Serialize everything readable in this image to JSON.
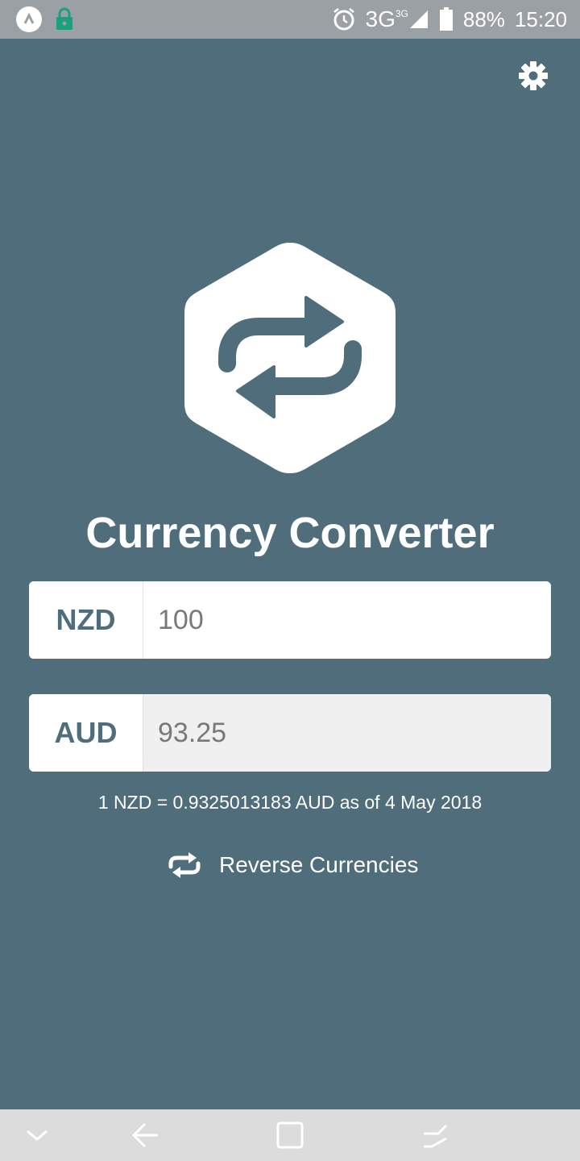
{
  "status_bar": {
    "network": "3G",
    "network_sup": "3G",
    "battery": "88%",
    "time": "15:20"
  },
  "app": {
    "title": "Currency Converter",
    "base_currency": "NZD",
    "base_amount": "100",
    "quote_currency": "AUD",
    "quote_amount": "93.25",
    "rate_text": "1 NZD = 0.9325013183 AUD as of 4 May 2018",
    "reverse_label": "Reverse Currencies"
  },
  "icons": {
    "settings": "gear-icon",
    "logo": "swap-arrows-icon",
    "reverse": "repeat-icon"
  },
  "colors": {
    "background": "#4f6d7a",
    "status_bar": "#9aa0a3",
    "nav_bar": "#dcdcdc",
    "input_bg": "#ffffff",
    "readonly_bg": "#f0f0f0"
  }
}
